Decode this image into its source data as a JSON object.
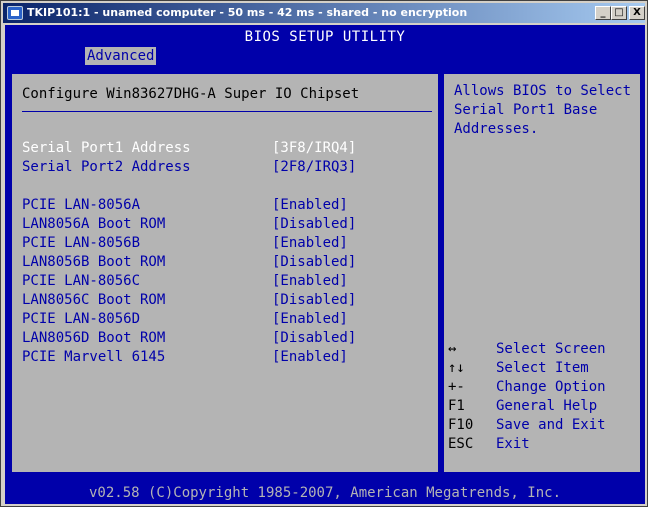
{
  "window": {
    "title": "TKIP101:1 - unamed computer - 50 ms - 42 ms - shared - no encryption",
    "min_glyph": "_",
    "max_glyph": "□",
    "close_glyph": "X"
  },
  "bios": {
    "title": "BIOS SETUP UTILITY",
    "active_tab": "Advanced",
    "section_title": "Configure Win83627DHG-A Super IO Chipset",
    "settings": [
      {
        "label": "Serial Port1 Address",
        "value": "[3F8/IRQ4]",
        "selected": true
      },
      {
        "label": "Serial Port2 Address",
        "value": "[2F8/IRQ3]",
        "selected": false
      },
      {
        "label": "PCIE LAN-8056A",
        "value": "[Enabled]",
        "selected": false
      },
      {
        "label": "LAN8056A Boot ROM",
        "value": "[Disabled]",
        "selected": false
      },
      {
        "label": "PCIE LAN-8056B",
        "value": "[Enabled]",
        "selected": false
      },
      {
        "label": "LAN8056B Boot ROM",
        "value": "[Disabled]",
        "selected": false
      },
      {
        "label": "PCIE LAN-8056C",
        "value": "[Enabled]",
        "selected": false
      },
      {
        "label": "LAN8056C Boot ROM",
        "value": "[Disabled]",
        "selected": false
      },
      {
        "label": "PCIE LAN-8056D",
        "value": "[Enabled]",
        "selected": false
      },
      {
        "label": "LAN8056D Boot ROM",
        "value": "[Disabled]",
        "selected": false
      },
      {
        "label": "PCIE Marvell 6145",
        "value": "[Enabled]",
        "selected": false
      }
    ],
    "help_text": "Allows BIOS to Select\nSerial Port1 Base\nAddresses.",
    "keys": [
      {
        "key": "↔",
        "desc": "Select Screen"
      },
      {
        "key": "↑↓",
        "desc": "Select Item"
      },
      {
        "key": "+-",
        "desc": "Change Option"
      },
      {
        "key": "F1",
        "desc": "General Help"
      },
      {
        "key": "F10",
        "desc": "Save and Exit"
      },
      {
        "key": "ESC",
        "desc": "Exit"
      }
    ],
    "footer": "v02.58 (C)Copyright 1985-2007, American Megatrends, Inc."
  },
  "colors": {
    "bios_blue": "#0000aa",
    "bios_gray": "#b4b4b4",
    "selected_text": "#ffffff"
  }
}
